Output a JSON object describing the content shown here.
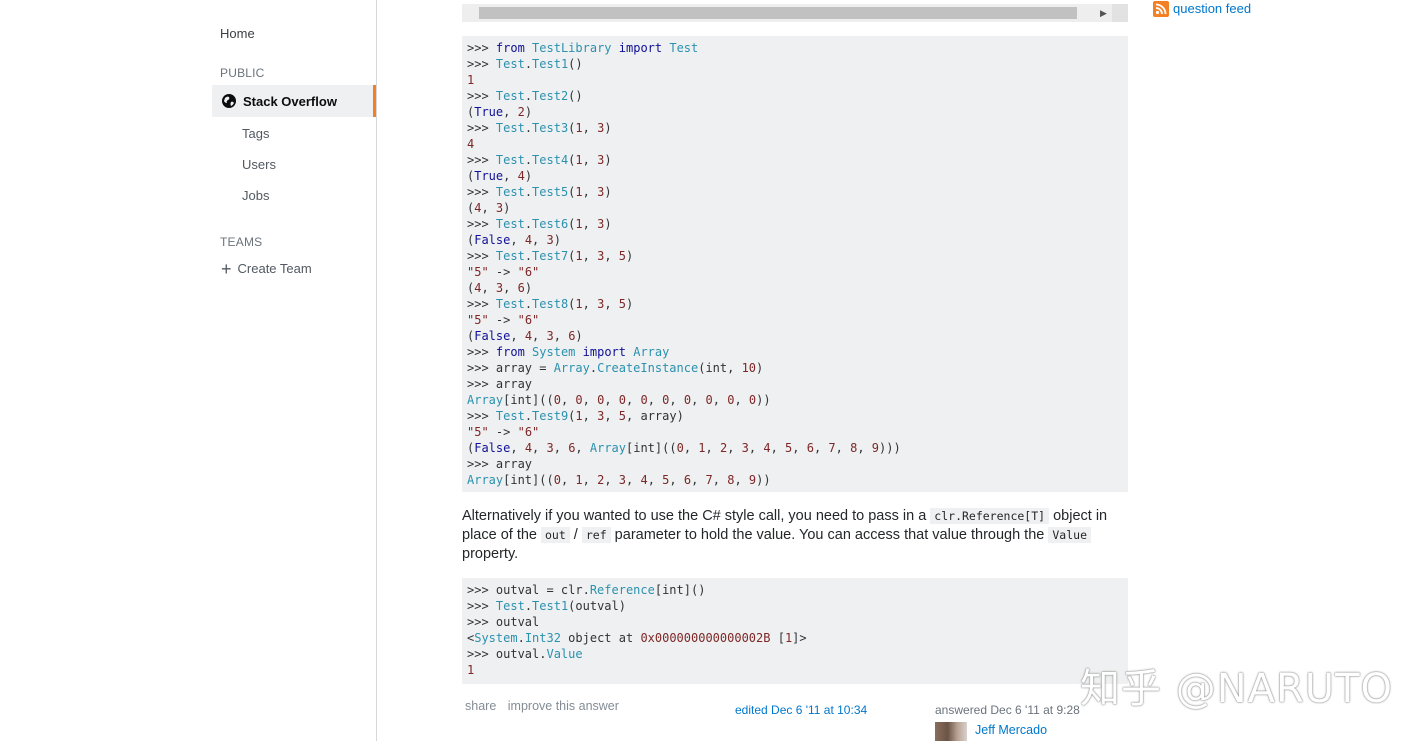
{
  "sidebar": {
    "home": "Home",
    "public_header": "PUBLIC",
    "stack_overflow": "Stack Overflow",
    "tags": "Tags",
    "users": "Users",
    "jobs": "Jobs",
    "teams_header": "TEAMS",
    "create_team": "Create Team"
  },
  "right": {
    "question_feed": "question feed",
    "rss_color": "#f48024"
  },
  "code_block_1": [
    [
      [
        "p",
        ">>> "
      ],
      [
        "kw",
        "from"
      ],
      [
        "p",
        " "
      ],
      [
        "nm",
        "TestLibrary"
      ],
      [
        "p",
        " "
      ],
      [
        "kw",
        "import"
      ],
      [
        "p",
        " "
      ],
      [
        "nm",
        "Test"
      ]
    ],
    [
      [
        "p",
        ">>> "
      ],
      [
        "nm",
        "Test"
      ],
      [
        "p",
        "."
      ],
      [
        "nm",
        "Test1"
      ],
      [
        "p",
        "()"
      ]
    ],
    [
      [
        "lit",
        "1"
      ]
    ],
    [
      [
        "p",
        ">>> "
      ],
      [
        "nm",
        "Test"
      ],
      [
        "p",
        "."
      ],
      [
        "nm",
        "Test2"
      ],
      [
        "p",
        "()"
      ]
    ],
    [
      [
        "p",
        "("
      ],
      [
        "kw",
        "True"
      ],
      [
        "p",
        ", "
      ],
      [
        "lit",
        "2"
      ],
      [
        "p",
        ")"
      ]
    ],
    [
      [
        "p",
        ">>> "
      ],
      [
        "nm",
        "Test"
      ],
      [
        "p",
        "."
      ],
      [
        "nm",
        "Test3"
      ],
      [
        "p",
        "("
      ],
      [
        "lit",
        "1"
      ],
      [
        "p",
        ", "
      ],
      [
        "lit",
        "3"
      ],
      [
        "p",
        ")"
      ]
    ],
    [
      [
        "lit",
        "4"
      ]
    ],
    [
      [
        "p",
        ">>> "
      ],
      [
        "nm",
        "Test"
      ],
      [
        "p",
        "."
      ],
      [
        "nm",
        "Test4"
      ],
      [
        "p",
        "("
      ],
      [
        "lit",
        "1"
      ],
      [
        "p",
        ", "
      ],
      [
        "lit",
        "3"
      ],
      [
        "p",
        ")"
      ]
    ],
    [
      [
        "p",
        "("
      ],
      [
        "kw",
        "True"
      ],
      [
        "p",
        ", "
      ],
      [
        "lit",
        "4"
      ],
      [
        "p",
        ")"
      ]
    ],
    [
      [
        "p",
        ">>> "
      ],
      [
        "nm",
        "Test"
      ],
      [
        "p",
        "."
      ],
      [
        "nm",
        "Test5"
      ],
      [
        "p",
        "("
      ],
      [
        "lit",
        "1"
      ],
      [
        "p",
        ", "
      ],
      [
        "lit",
        "3"
      ],
      [
        "p",
        ")"
      ]
    ],
    [
      [
        "p",
        "("
      ],
      [
        "lit",
        "4"
      ],
      [
        "p",
        ", "
      ],
      [
        "lit",
        "3"
      ],
      [
        "p",
        ")"
      ]
    ],
    [
      [
        "p",
        ">>> "
      ],
      [
        "nm",
        "Test"
      ],
      [
        "p",
        "."
      ],
      [
        "nm",
        "Test6"
      ],
      [
        "p",
        "("
      ],
      [
        "lit",
        "1"
      ],
      [
        "p",
        ", "
      ],
      [
        "lit",
        "3"
      ],
      [
        "p",
        ")"
      ]
    ],
    [
      [
        "p",
        "("
      ],
      [
        "kw",
        "False"
      ],
      [
        "p",
        ", "
      ],
      [
        "lit",
        "4"
      ],
      [
        "p",
        ", "
      ],
      [
        "lit",
        "3"
      ],
      [
        "p",
        ")"
      ]
    ],
    [
      [
        "p",
        ">>> "
      ],
      [
        "nm",
        "Test"
      ],
      [
        "p",
        "."
      ],
      [
        "nm",
        "Test7"
      ],
      [
        "p",
        "("
      ],
      [
        "lit",
        "1"
      ],
      [
        "p",
        ", "
      ],
      [
        "lit",
        "3"
      ],
      [
        "p",
        ", "
      ],
      [
        "lit",
        "5"
      ],
      [
        "p",
        ")"
      ]
    ],
    [
      [
        "str",
        "\"5\""
      ],
      [
        "p",
        " -> "
      ],
      [
        "str",
        "\"6\""
      ]
    ],
    [
      [
        "p",
        "("
      ],
      [
        "lit",
        "4"
      ],
      [
        "p",
        ", "
      ],
      [
        "lit",
        "3"
      ],
      [
        "p",
        ", "
      ],
      [
        "lit",
        "6"
      ],
      [
        "p",
        ")"
      ]
    ],
    [
      [
        "p",
        ">>> "
      ],
      [
        "nm",
        "Test"
      ],
      [
        "p",
        "."
      ],
      [
        "nm",
        "Test8"
      ],
      [
        "p",
        "("
      ],
      [
        "lit",
        "1"
      ],
      [
        "p",
        ", "
      ],
      [
        "lit",
        "3"
      ],
      [
        "p",
        ", "
      ],
      [
        "lit",
        "5"
      ],
      [
        "p",
        ")"
      ]
    ],
    [
      [
        "str",
        "\"5\""
      ],
      [
        "p",
        " -> "
      ],
      [
        "str",
        "\"6\""
      ]
    ],
    [
      [
        "p",
        "("
      ],
      [
        "kw",
        "False"
      ],
      [
        "p",
        ", "
      ],
      [
        "lit",
        "4"
      ],
      [
        "p",
        ", "
      ],
      [
        "lit",
        "3"
      ],
      [
        "p",
        ", "
      ],
      [
        "lit",
        "6"
      ],
      [
        "p",
        ")"
      ]
    ],
    [
      [
        "p",
        ">>> "
      ],
      [
        "kw",
        "from"
      ],
      [
        "p",
        " "
      ],
      [
        "nm",
        "System"
      ],
      [
        "p",
        " "
      ],
      [
        "kw",
        "import"
      ],
      [
        "p",
        " "
      ],
      [
        "nm",
        "Array"
      ]
    ],
    [
      [
        "p",
        ">>> array = "
      ],
      [
        "nm",
        "Array"
      ],
      [
        "p",
        "."
      ],
      [
        "nm",
        "CreateInstance"
      ],
      [
        "p",
        "(int, "
      ],
      [
        "lit",
        "10"
      ],
      [
        "p",
        ")"
      ]
    ],
    [
      [
        "p",
        ">>> array"
      ]
    ],
    [
      [
        "nm",
        "Array"
      ],
      [
        "p",
        "[int](("
      ],
      [
        "lit",
        "0"
      ],
      [
        "p",
        ", "
      ],
      [
        "lit",
        "0"
      ],
      [
        "p",
        ", "
      ],
      [
        "lit",
        "0"
      ],
      [
        "p",
        ", "
      ],
      [
        "lit",
        "0"
      ],
      [
        "p",
        ", "
      ],
      [
        "lit",
        "0"
      ],
      [
        "p",
        ", "
      ],
      [
        "lit",
        "0"
      ],
      [
        "p",
        ", "
      ],
      [
        "lit",
        "0"
      ],
      [
        "p",
        ", "
      ],
      [
        "lit",
        "0"
      ],
      [
        "p",
        ", "
      ],
      [
        "lit",
        "0"
      ],
      [
        "p",
        ", "
      ],
      [
        "lit",
        "0"
      ],
      [
        "p",
        "))"
      ]
    ],
    [
      [
        "p",
        ">>> "
      ],
      [
        "nm",
        "Test"
      ],
      [
        "p",
        "."
      ],
      [
        "nm",
        "Test9"
      ],
      [
        "p",
        "("
      ],
      [
        "lit",
        "1"
      ],
      [
        "p",
        ", "
      ],
      [
        "lit",
        "3"
      ],
      [
        "p",
        ", "
      ],
      [
        "lit",
        "5"
      ],
      [
        "p",
        ", array)"
      ]
    ],
    [
      [
        "str",
        "\"5\""
      ],
      [
        "p",
        " -> "
      ],
      [
        "str",
        "\"6\""
      ]
    ],
    [
      [
        "p",
        "("
      ],
      [
        "kw",
        "False"
      ],
      [
        "p",
        ", "
      ],
      [
        "lit",
        "4"
      ],
      [
        "p",
        ", "
      ],
      [
        "lit",
        "3"
      ],
      [
        "p",
        ", "
      ],
      [
        "lit",
        "6"
      ],
      [
        "p",
        ", "
      ],
      [
        "nm",
        "Array"
      ],
      [
        "p",
        "[int](("
      ],
      [
        "lit",
        "0"
      ],
      [
        "p",
        ", "
      ],
      [
        "lit",
        "1"
      ],
      [
        "p",
        ", "
      ],
      [
        "lit",
        "2"
      ],
      [
        "p",
        ", "
      ],
      [
        "lit",
        "3"
      ],
      [
        "p",
        ", "
      ],
      [
        "lit",
        "4"
      ],
      [
        "p",
        ", "
      ],
      [
        "lit",
        "5"
      ],
      [
        "p",
        ", "
      ],
      [
        "lit",
        "6"
      ],
      [
        "p",
        ", "
      ],
      [
        "lit",
        "7"
      ],
      [
        "p",
        ", "
      ],
      [
        "lit",
        "8"
      ],
      [
        "p",
        ", "
      ],
      [
        "lit",
        "9"
      ],
      [
        "p",
        ")))"
      ]
    ],
    [
      [
        "p",
        ">>> array"
      ]
    ],
    [
      [
        "nm",
        "Array"
      ],
      [
        "p",
        "[int](("
      ],
      [
        "lit",
        "0"
      ],
      [
        "p",
        ", "
      ],
      [
        "lit",
        "1"
      ],
      [
        "p",
        ", "
      ],
      [
        "lit",
        "2"
      ],
      [
        "p",
        ", "
      ],
      [
        "lit",
        "3"
      ],
      [
        "p",
        ", "
      ],
      [
        "lit",
        "4"
      ],
      [
        "p",
        ", "
      ],
      [
        "lit",
        "5"
      ],
      [
        "p",
        ", "
      ],
      [
        "lit",
        "6"
      ],
      [
        "p",
        ", "
      ],
      [
        "lit",
        "7"
      ],
      [
        "p",
        ", "
      ],
      [
        "lit",
        "8"
      ],
      [
        "p",
        ", "
      ],
      [
        "lit",
        "9"
      ],
      [
        "p",
        "))"
      ]
    ]
  ],
  "paragraph": {
    "t1": "Alternatively if you wanted to use the C# style call, you need to pass in a ",
    "c1": "clr.Reference[T]",
    "t2": " object in place of the ",
    "c2": "out",
    "t3": " / ",
    "c3": "ref",
    "t4": " parameter to hold the value. You can access that value through the ",
    "c4": "Value",
    "t5": " property."
  },
  "code_block_2": [
    [
      [
        "p",
        ">>> outval = clr."
      ],
      [
        "nm",
        "Reference"
      ],
      [
        "p",
        "[int]()"
      ]
    ],
    [
      [
        "p",
        ">>> "
      ],
      [
        "nm",
        "Test"
      ],
      [
        "p",
        "."
      ],
      [
        "nm",
        "Test1"
      ],
      [
        "p",
        "(outval)"
      ]
    ],
    [
      [
        "p",
        ">>> outval"
      ]
    ],
    [
      [
        "p",
        "<"
      ],
      [
        "nm",
        "System"
      ],
      [
        "p",
        "."
      ],
      [
        "nm",
        "Int32"
      ],
      [
        "p",
        " object at "
      ],
      [
        "lit",
        "0x000000000000002B"
      ],
      [
        "p",
        " ["
      ],
      [
        "lit",
        "1"
      ],
      [
        "p",
        "]>"
      ]
    ],
    [
      [
        "p",
        ">>> outval."
      ],
      [
        "nm",
        "Value"
      ]
    ],
    [
      [
        "lit",
        "1"
      ]
    ]
  ],
  "post_menu": {
    "share": "share",
    "improve": "improve this answer"
  },
  "edited": "edited Dec 6 '11 at 10:34",
  "answered": "answered Dec 6 '11 at 9:28",
  "user_name": "Jeff Mercado",
  "watermark": "知乎 @NARUTO"
}
